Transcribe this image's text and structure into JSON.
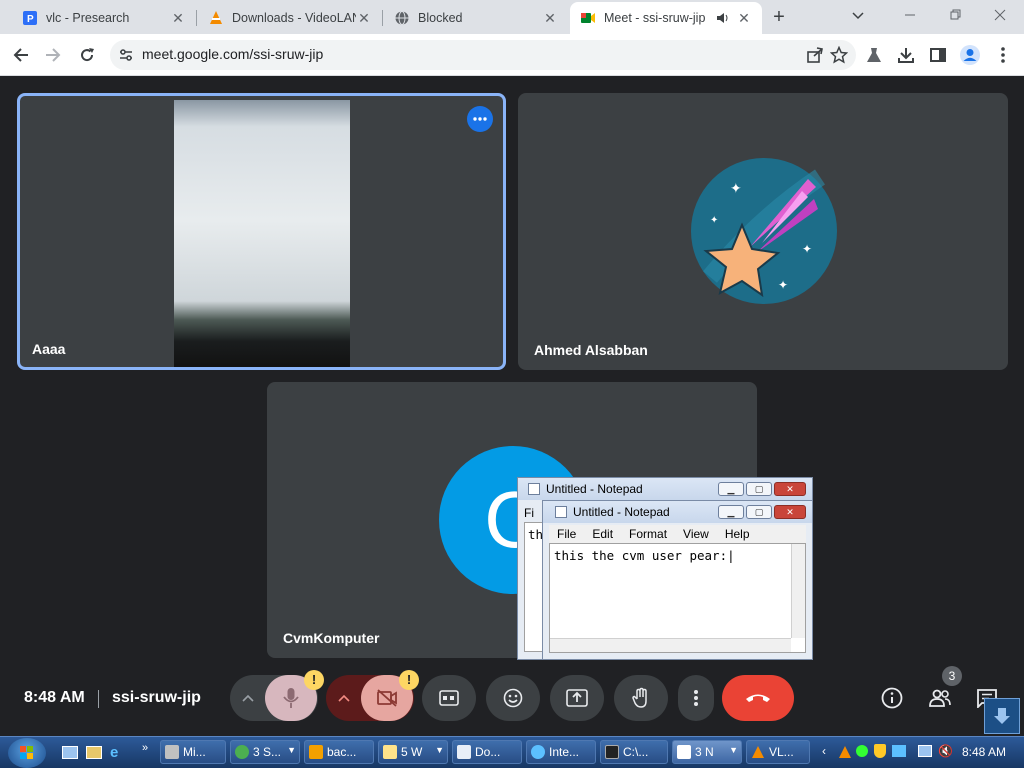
{
  "browser": {
    "tabs": [
      {
        "title": "vlc - Presearch",
        "icon": "presearch-icon"
      },
      {
        "title": "Downloads - VideoLAN",
        "icon": "vlc-cone-icon"
      },
      {
        "title": "Blocked",
        "icon": "globe-icon"
      },
      {
        "title": "Meet - ssi-sruw-jip",
        "icon": "meet-icon",
        "active": true
      }
    ],
    "close_glyph": "✕",
    "new_tab_glyph": "+",
    "address": "meet.google.com/ssi-sruw-jip"
  },
  "meet": {
    "participants": [
      {
        "name": "Aaaa"
      },
      {
        "name": "Ahmed Alsabban"
      },
      {
        "name": "CvmKomputer",
        "initial": "C"
      }
    ],
    "time": "8:48 AM",
    "meeting_code": "ssi-sruw-jip",
    "participant_count": "3",
    "warning_glyph": "!",
    "accent_color": "#8ab4f8",
    "end_call_color": "#ea4335"
  },
  "notepad_back": {
    "title": "Untitled - Notepad",
    "menu_first": "Fi",
    "text_clip": "th"
  },
  "notepad": {
    "title": "Untitled - Notepad",
    "menu": [
      "File",
      "Edit",
      "Format",
      "View",
      "Help"
    ],
    "content": "this the cvm user pear:|"
  },
  "taskbar": {
    "items": [
      {
        "label": "Mi..."
      },
      {
        "label": "3 S..."
      },
      {
        "label": "bac..."
      },
      {
        "label": "5 W"
      },
      {
        "label": "Do..."
      },
      {
        "label": "Inte..."
      },
      {
        "label": "C:\\..."
      },
      {
        "label": "3 N"
      },
      {
        "label": "VL..."
      }
    ],
    "clock": "8:48 AM"
  }
}
